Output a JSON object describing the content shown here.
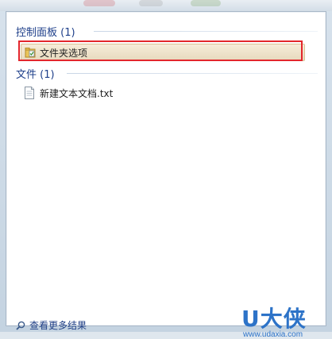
{
  "groups": {
    "control_panel": {
      "header": "控制面板 (1)",
      "items": [
        {
          "label": "文件夹选项",
          "icon": "folder-options-icon"
        }
      ]
    },
    "files": {
      "header": "文件 (1)",
      "items": [
        {
          "label": "新建文本文档.txt",
          "icon": "text-document-icon"
        }
      ]
    }
  },
  "footer": {
    "see_more": "查看更多结果",
    "icon": "search-icon"
  },
  "watermark": {
    "logo": "U大侠",
    "url": "www.udaxia.com"
  },
  "colors": {
    "group_header": "#1e3f8a",
    "selection_bg": "#efe3ca",
    "highlight_border": "#e3262c",
    "watermark": "#2d73c8"
  }
}
